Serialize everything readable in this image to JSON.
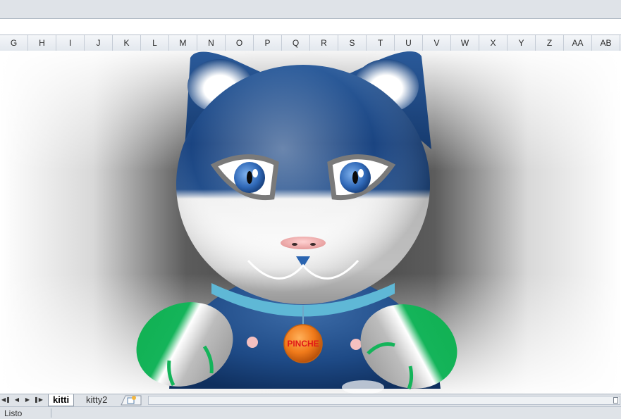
{
  "columns": [
    "G",
    "H",
    "I",
    "J",
    "K",
    "L",
    "M",
    "N",
    "O",
    "P",
    "Q",
    "R",
    "S",
    "T",
    "U",
    "V",
    "W",
    "X",
    "Y",
    "Z",
    "AA",
    "AB"
  ],
  "sheets": [
    {
      "label": "kitti",
      "active": true
    },
    {
      "label": "kitty2",
      "active": false
    }
  ],
  "status": {
    "text": "Listo"
  },
  "artwork": {
    "pendant_text": "PINCHE"
  },
  "colors": {
    "cat_blue": "#1f4b88",
    "paw_green": "#14b45a",
    "pendant_orange": "#f07a1a",
    "pendant_text": "#e11818",
    "collar": "#5fb8d6"
  },
  "icons": {
    "first_sheet": "first-sheet-icon",
    "prev_sheet": "prev-sheet-icon",
    "next_sheet": "next-sheet-icon",
    "last_sheet": "last-sheet-icon",
    "insert_sheet": "insert-sheet-icon"
  }
}
